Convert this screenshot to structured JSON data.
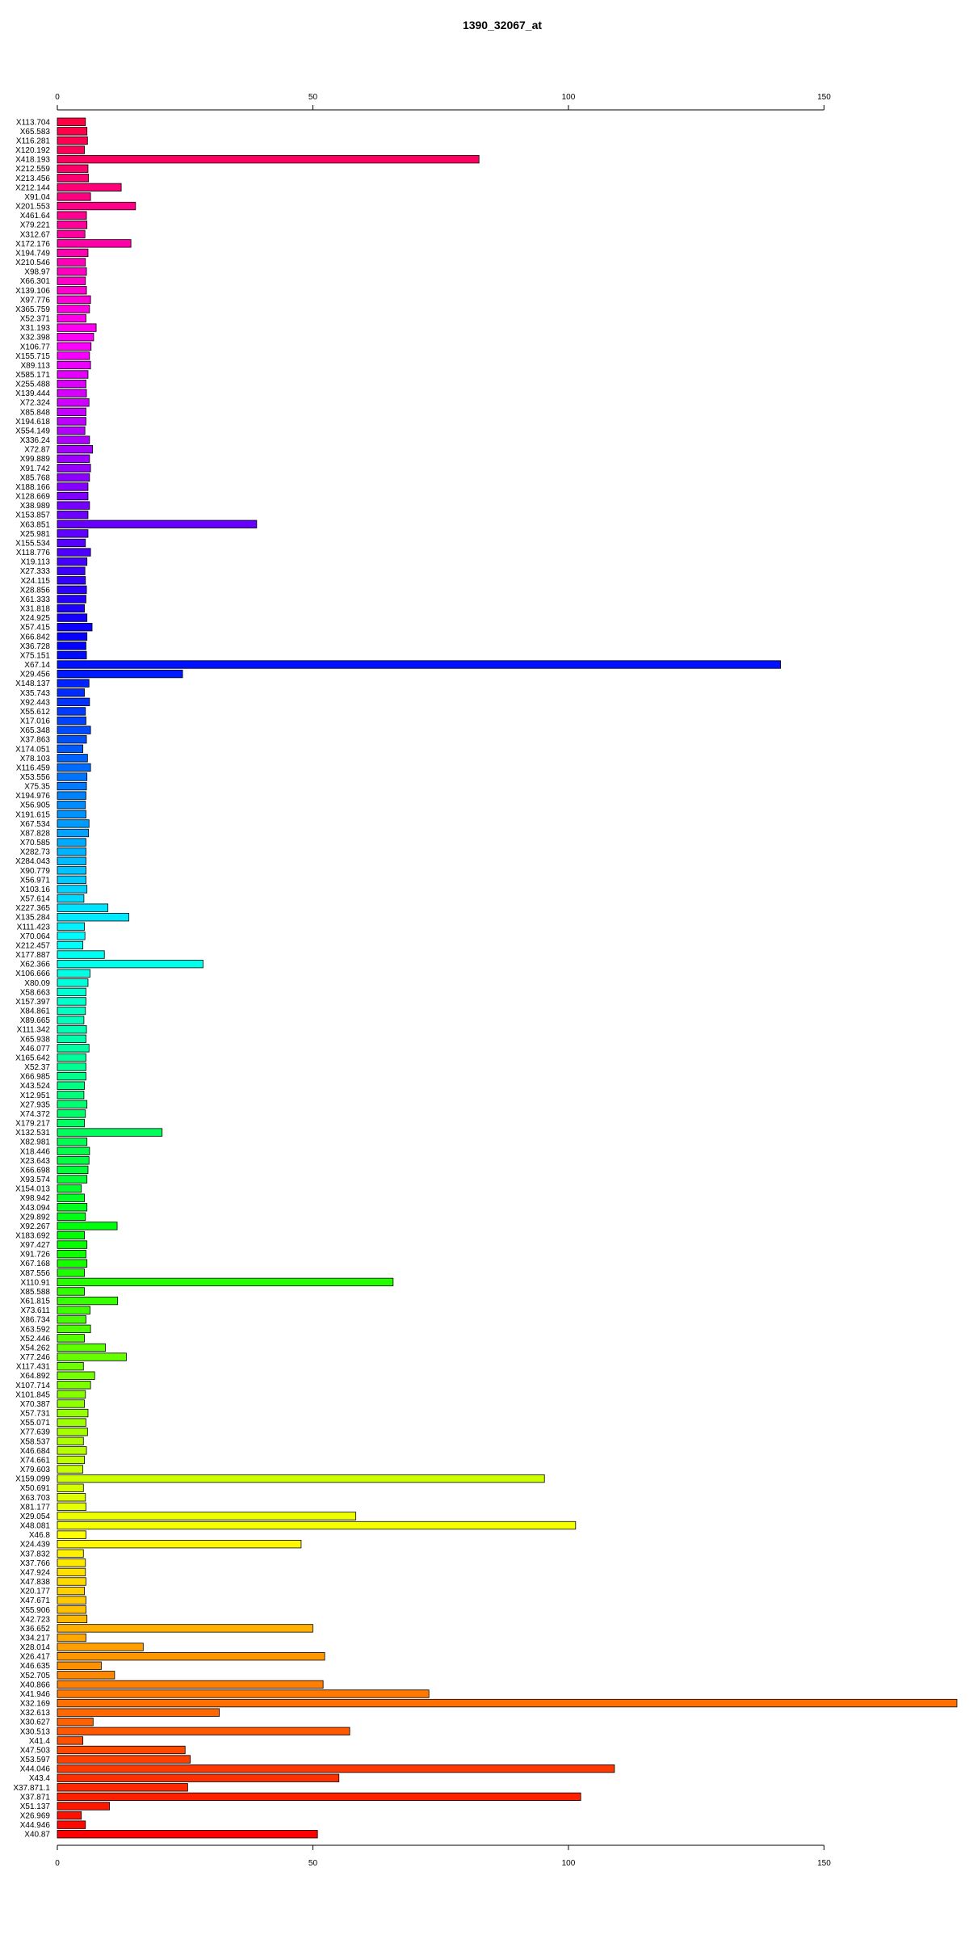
{
  "chart_data": {
    "type": "bar",
    "orientation": "horizontal",
    "title": "1390_32067_at",
    "xlabel": "",
    "ylabel": "",
    "xlim": [
      0,
      176
    ],
    "xticks": [
      0,
      50,
      100,
      150
    ],
    "axes": [
      "top",
      "bottom"
    ],
    "grid": false,
    "legend": "none",
    "color_scheme": "rainbow",
    "categories": [
      "X113.704",
      "X65.583",
      "X116.281",
      "X120.192",
      "X418.193",
      "X212.559",
      "X213.456",
      "X212.144",
      "X91.04",
      "X201.553",
      "X461.64",
      "X79.221",
      "X312.67",
      "X172.176",
      "X194.749",
      "X210.546",
      "X98.97",
      "X66.301",
      "X139.106",
      "X97.776",
      "X365.759",
      "X52.371",
      "X31.193",
      "X32.398",
      "X106.77",
      "X155.715",
      "X89.113",
      "X585.171",
      "X255.488",
      "X139.444",
      "X72.324",
      "X85.848",
      "X194.618",
      "X554.149",
      "X336.24",
      "X72.87",
      "X99.889",
      "X91.742",
      "X85.768",
      "X188.166",
      "X128.669",
      "X38.989",
      "X153.857",
      "X63.851",
      "X25.981",
      "X155.534",
      "X118.776",
      "X19.113",
      "X27.333",
      "X24.115",
      "X28.856",
      "X61.333",
      "X31.818",
      "X24.925",
      "X57.415",
      "X66.842",
      "X36.728",
      "X75.151",
      "X67.14",
      "X29.456",
      "X148.137",
      "X35.743",
      "X92.443",
      "X55.612",
      "X17.016",
      "X65.348",
      "X37.863",
      "X174.051",
      "X78.103",
      "X116.459",
      "X53.556",
      "X75.35",
      "X194.976",
      "X56.905",
      "X191.615",
      "X67.534",
      "X87.828",
      "X70.585",
      "X282.73",
      "X284.043",
      "X90.779",
      "X56.971",
      "X103.16",
      "X57.614",
      "X227.365",
      "X135.284",
      "X111.423",
      "X70.064",
      "X212.457",
      "X177.887",
      "X62.366",
      "X106.666",
      "X80.09",
      "X58.663",
      "X157.397",
      "X84.861",
      "X89.665",
      "X111.342",
      "X65.938",
      "X46.077",
      "X165.642",
      "X52.37",
      "X66.985",
      "X43.524",
      "X12.951",
      "X27.935",
      "X74.372",
      "X179.217",
      "X132.531",
      "X82.981",
      "X18.446",
      "X23.643",
      "X66.698",
      "X93.574",
      "X154.013",
      "X98.942",
      "X43.094",
      "X29.892",
      "X92.267",
      "X183.692",
      "X97.427",
      "X91.726",
      "X67.168",
      "X87.556",
      "X110.91",
      "X85.588",
      "X61.815",
      "X73.611",
      "X86.734",
      "X63.592",
      "X52.446",
      "X54.262",
      "X77.246",
      "X117.431",
      "X64.892",
      "X107.714",
      "X101.845",
      "X70.387",
      "X57.731",
      "X55.071",
      "X77.639",
      "X58.537",
      "X46.684",
      "X74.661",
      "X79.603",
      "X159.099",
      "X50.691",
      "X63.703",
      "X81.177",
      "X29.054",
      "X48.081",
      "X46.8",
      "X24.439",
      "X37.832",
      "X37.766",
      "X47.924",
      "X47.838",
      "X20.177",
      "X47.671",
      "X55.906",
      "X42.723",
      "X36.652",
      "X34.217",
      "X28.014",
      "X26.417",
      "X46.635",
      "X52.705",
      "X40.866",
      "X41.946",
      "X32.169",
      "X32.613",
      "X30.627",
      "X30.513",
      "X41.4",
      "X47.503",
      "X53.597",
      "X44.046",
      "X43.4",
      "X37.871.1",
      "X37.871",
      "X51.137",
      "X26.969",
      "X44.946",
      "X40.87"
    ],
    "values": [
      5.5,
      5.8,
      5.9,
      5.3,
      82.5,
      6.0,
      6.1,
      12.5,
      6.5,
      15.3,
      5.7,
      5.8,
      5.4,
      14.4,
      6.0,
      5.5,
      5.7,
      5.5,
      5.7,
      6.5,
      6.3,
      5.6,
      7.6,
      7.1,
      6.6,
      6.3,
      6.5,
      6.0,
      5.6,
      5.7,
      6.2,
      5.6,
      5.6,
      5.4,
      6.3,
      6.9,
      6.3,
      6.5,
      6.3,
      6.0,
      6.0,
      6.3,
      6.0,
      39.0,
      6.0,
      5.5,
      6.5,
      5.8,
      5.4,
      5.5,
      5.7,
      5.6,
      5.3,
      5.8,
      6.8,
      5.8,
      5.6,
      5.7,
      141.5,
      24.5,
      6.2,
      5.3,
      6.3,
      5.5,
      5.6,
      6.5,
      5.7,
      5.0,
      5.9,
      6.5,
      5.8,
      5.7,
      5.6,
      5.5,
      5.6,
      6.2,
      6.1,
      5.6,
      5.6,
      5.6,
      5.6,
      5.6,
      5.8,
      5.2,
      9.9,
      14.0,
      5.3,
      5.4,
      5.0,
      9.2,
      28.5,
      6.4,
      6.0,
      5.6,
      5.6,
      5.5,
      5.2,
      5.7,
      5.6,
      6.2,
      5.6,
      5.6,
      5.6,
      5.3,
      5.2,
      5.8,
      5.5,
      5.3,
      20.5,
      5.8,
      6.3,
      6.2,
      6.0,
      5.8,
      4.7,
      5.3,
      5.8,
      5.5,
      11.7,
      5.3,
      5.8,
      5.6,
      5.8,
      5.3,
      65.7,
      5.3,
      11.8,
      6.4,
      5.6,
      6.5,
      5.3,
      9.4,
      13.5,
      5.1,
      7.3,
      6.5,
      5.5,
      5.3,
      6.0,
      5.6,
      5.9,
      5.1,
      5.7,
      5.3,
      5.0,
      95.3,
      5.1,
      5.5,
      5.6,
      58.4,
      101.4,
      5.6,
      47.7,
      5.1,
      5.5,
      5.5,
      5.6,
      5.3,
      5.6,
      5.6,
      5.8,
      50.0,
      5.6,
      16.8,
      52.3,
      8.6,
      11.2,
      52.0,
      72.7,
      176.0,
      31.7,
      7.0,
      57.2,
      5.0,
      25.0,
      26.0,
      109.0,
      55.1,
      25.5,
      102.4,
      10.2,
      4.7,
      5.5,
      50.9
    ],
    "colors": [
      "#ff0026",
      "#ff0027",
      "#ff0029",
      "#ff002a",
      "#ff002c",
      "#ff002d",
      "#ff002f",
      "#ff0031",
      "#ff0032",
      "#ff0034",
      "#ff0035",
      "#ff0037",
      "#ff0038",
      "#ff003a",
      "#ff003b",
      "#ff003d",
      "#ff003f",
      "#ff0040",
      "#ff0042",
      "#ff0043",
      "#ff0045",
      "#ff0046",
      "#ff0048",
      "#ff004a",
      "#ff004b",
      "#ff004d",
      "#ff004e",
      "#ff0050",
      "#ff0051",
      "#ff0053",
      "#ff0055",
      "#ff0056",
      "#ff0058",
      "#ff0059",
      "#ff005b",
      "#ff005c",
      "#ff005e",
      "#ff0060",
      "#ff0061",
      "#ff0063",
      "#ff0064",
      "#ff0066",
      "#ff0067",
      "#ff0069",
      "#ff006b",
      "#ff006c",
      "#ff006e",
      "#ff006f",
      "#ff0071",
      "#ff0072",
      "#ff0074",
      "#ff0076",
      "#ff0077",
      "#ff0079",
      "#ff007a",
      "#ff007c",
      "#ff007d",
      "#ff007f",
      "#ff0080",
      "#ff0082",
      "#ff0084",
      "#ff0085",
      "#ff0087",
      "#ff0088",
      "#ff008a",
      "#ff008b",
      "#ff008d",
      "#ff008f",
      "#ff0090",
      "#ff0092",
      "#ff0093",
      "#ff0095",
      "#ff0096",
      "#ff0098",
      "#ff009a",
      "#ff009b",
      "#ff009d",
      "#ff009e",
      "#ff00a0",
      "#ff00a1",
      "#ff00a3",
      "#ff00a5",
      "#ff00a6",
      "#ff00a8",
      "#ff00a9",
      "#ff00ab",
      "#ff00ac",
      "#ff00ae",
      "#ff00b0",
      "#ff00b1",
      "#ff00b3",
      "#ff00b4",
      "#ff00b6",
      "#ff00b7",
      "#ff00b9",
      "#ff00bb",
      "#ff00bc",
      "#ff00be",
      "#ff00bf",
      "#ff00c1",
      "#ff00c2",
      "#ff00c4",
      "#ff00c6",
      "#ff00c7",
      "#ff00c9",
      "#ff00ca",
      "#ff00cc",
      "#ff00cd",
      "#ff00cf",
      "#ff00d1",
      "#ff00d2",
      "#ff00d4",
      "#ff00d5",
      "#ff00d7",
      "#ff00d8",
      "#ff00da",
      "#ff00dc",
      "#ff00dd",
      "#ff00df",
      "#ff00e0",
      "#ff00e2",
      "#ff00e3",
      "#ff00e5",
      "#ff00e7",
      "#ff00e8",
      "#ff00ea",
      "#ff00eb",
      "#ff00ed",
      "#ff00ee",
      "#ff00f0",
      "#ff00f2",
      "#ff00f3",
      "#ff00f5",
      "#ff00f6",
      "#ff00f8",
      "#ff00f9",
      "#ff00fb",
      "#ff00fd",
      "#ff00fe",
      "#fe00ff",
      "#fc00ff",
      "#fb00ff",
      "#f900ff",
      "#f800ff",
      "#f600ff",
      "#f400ff",
      "#f300ff",
      "#f100ff",
      "#f000ff",
      "#ee00ff",
      "#ed00ff",
      "#eb00ff",
      "#ea00ff",
      "#e800ff",
      "#e600ff",
      "#e500ff",
      "#e300ff",
      "#e200ff",
      "#e000ff",
      "#df00ff",
      "#dd00ff",
      "#db00ff",
      "#da00ff",
      "#d800ff",
      "#d700ff",
      "#d500ff",
      "#d400ff",
      "#d200ff",
      "#d000ff",
      "#cf00ff",
      "#cd00ff",
      "#cc00ff",
      "#ca00ff",
      "#c900ff",
      "#c700ff",
      "#c500ff",
      "#c400ff",
      "#c200ff",
      "#c100ff"
    ]
  }
}
